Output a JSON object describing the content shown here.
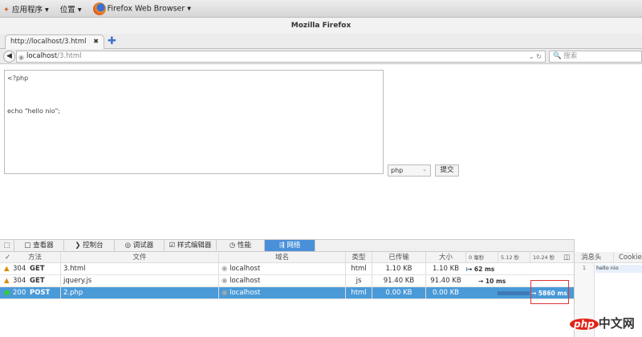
{
  "gnome": {
    "apps": "应用程序 ▾",
    "places": "位置 ▾",
    "browser": "Firefox Web Browser ▾"
  },
  "window_title": "Mozilla Firefox",
  "tab": {
    "title": "http://localhost/3.html",
    "close": "✖",
    "new": "✚"
  },
  "nav": {
    "url_host": "localhost",
    "url_path": "/3.html",
    "search_placeholder": "🔍 搜索"
  },
  "page": {
    "code": "<?php\n\n\necho \"hello nio\";",
    "lang": "php",
    "submit": "提交"
  },
  "devtools": {
    "tabs": [
      "查看器",
      "控制台",
      "调试器",
      "样式编辑器",
      "性能",
      "网络"
    ],
    "tab_icons": [
      "□",
      "❯",
      "◎",
      "☑",
      "◷",
      "⇶"
    ],
    "active_tab": "网络",
    "headers": {
      "check": "✓",
      "method": "方法",
      "file": "文件",
      "domain": "域名",
      "type": "类型",
      "transferred": "已传输",
      "size": "大小",
      "t0": "0 毫秒",
      "t1": "5.12 秒",
      "t2": "10.24 秒"
    },
    "rows": [
      {
        "status": "304",
        "method": "GET",
        "file": "3.html",
        "domain": "localhost",
        "type": "html",
        "transferred": "1.10 KB",
        "size": "1.10 KB",
        "timing": "→ 62 ms"
      },
      {
        "status": "304",
        "method": "GET",
        "file": "jquery.js",
        "domain": "localhost",
        "type": "js",
        "transferred": "91.40 KB",
        "size": "91.40 KB",
        "timing": "→ 10 ms"
      },
      {
        "status": "200",
        "method": "POST",
        "file": "2.php",
        "domain": "localhost",
        "type": "html",
        "transferred": "0.00 KB",
        "size": "0.00 KB",
        "timing": "→ 5860 ms"
      }
    ],
    "sidebar": {
      "tab1": "消息头",
      "tab2": "Cookie",
      "line": "1",
      "response": "hello nio"
    }
  },
  "watermark": {
    "logo": "php",
    "text": "中文网"
  }
}
